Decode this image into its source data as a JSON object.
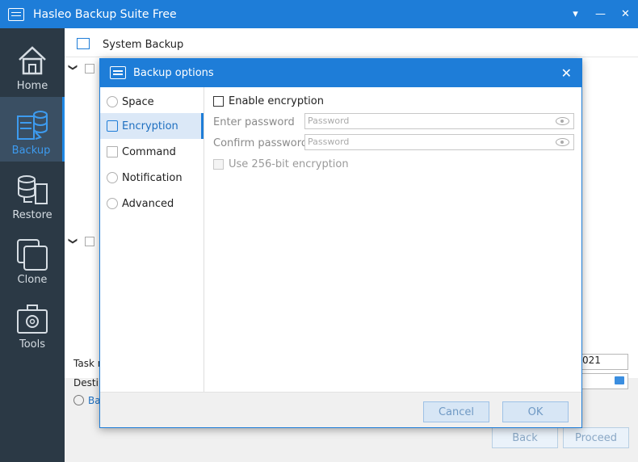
{
  "window": {
    "title": "Hasleo Backup Suite Free",
    "controls": [
      "▾",
      "—",
      "✕"
    ]
  },
  "sidebar": {
    "items": [
      {
        "label": "Home",
        "icon": "home-icon",
        "active": false
      },
      {
        "label": "Backup",
        "icon": "backup-icon",
        "active": true
      },
      {
        "label": "Restore",
        "icon": "restore-icon",
        "active": false
      },
      {
        "label": "Clone",
        "icon": "clone-icon",
        "active": false
      },
      {
        "label": "Tools",
        "icon": "tools-icon",
        "active": false
      }
    ]
  },
  "main": {
    "title": "System Backup",
    "task_label": "Task n",
    "task_value": "021",
    "dest_label": "Destin",
    "backup_link": "Ba",
    "back_label": "Back",
    "proceed_label": "Proceed"
  },
  "dialog": {
    "title": "Backup options",
    "close": "✕",
    "nav": [
      {
        "label": "Space",
        "active": false
      },
      {
        "label": "Encryption",
        "active": true
      },
      {
        "label": "Command",
        "active": false
      },
      {
        "label": "Notification",
        "active": false
      },
      {
        "label": "Advanced",
        "active": false
      }
    ],
    "enable_encryption": "Enable encryption",
    "enter_password_label": "Enter password",
    "confirm_password_label": "Confirm password",
    "password_placeholder": "Password",
    "use_256": "Use 256-bit encryption",
    "cancel_label": "Cancel",
    "ok_label": "OK"
  },
  "colors": {
    "accent": "#1e7dd8",
    "sidebar_bg": "#2b3945",
    "sidebar_active": "#3a4f63"
  }
}
